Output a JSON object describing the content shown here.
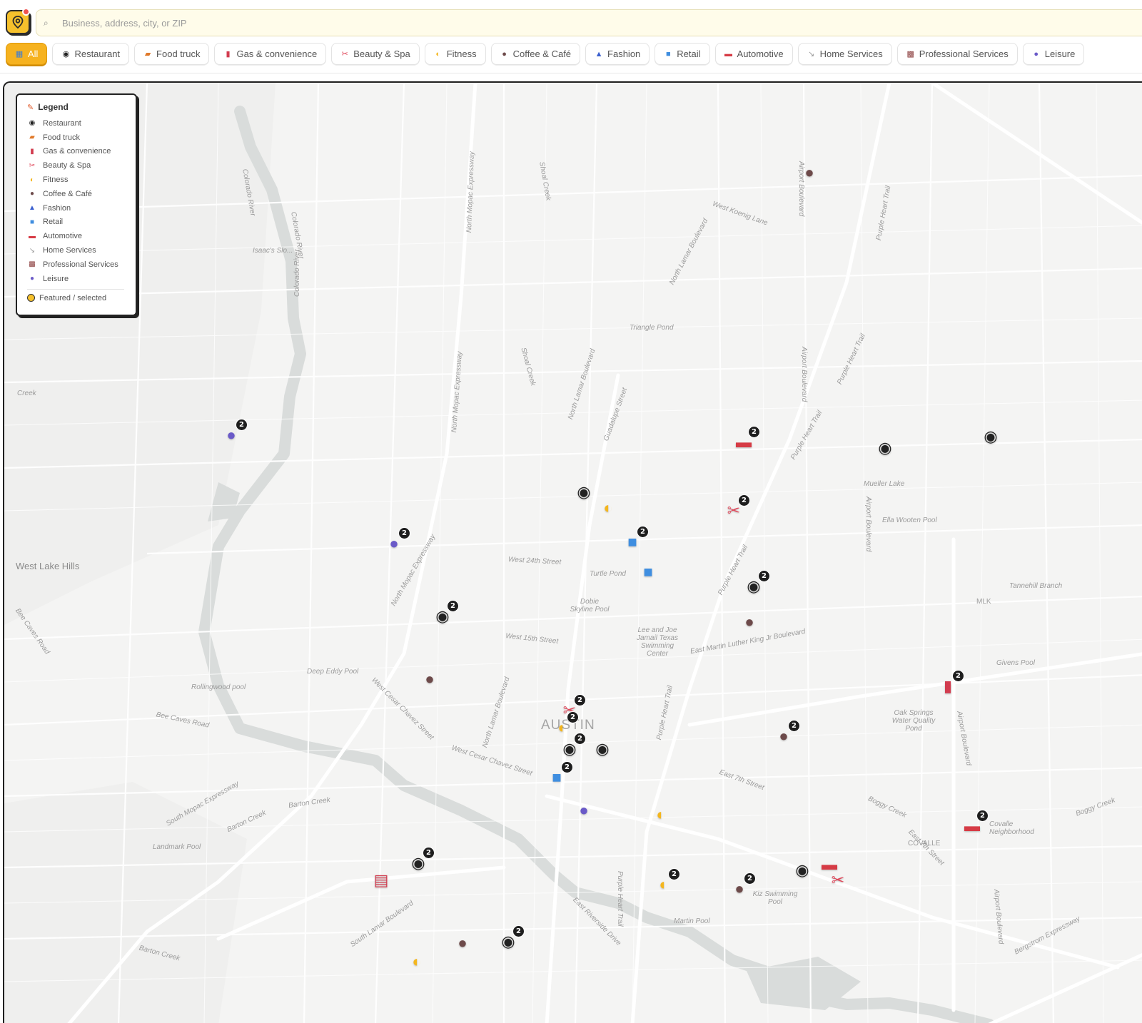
{
  "search": {
    "placeholder": "Business, address, city, or ZIP"
  },
  "chips": [
    {
      "label": "All",
      "icon": "grid-icon",
      "active": true
    },
    {
      "label": "Restaurant",
      "icon": "restaurant-icon"
    },
    {
      "label": "Food truck",
      "icon": "food-truck-icon"
    },
    {
      "label": "Gas & convenience",
      "icon": "gas-pump-icon"
    },
    {
      "label": "Beauty & Spa",
      "icon": "scissors-icon"
    },
    {
      "label": "Fitness",
      "icon": "flexed-arm-icon"
    },
    {
      "label": "Coffee & Café",
      "icon": "coffee-icon"
    },
    {
      "label": "Fashion",
      "icon": "dress-icon"
    },
    {
      "label": "Retail",
      "icon": "shopping-bag-icon"
    },
    {
      "label": "Automotive",
      "icon": "car-icon"
    },
    {
      "label": "Home Services",
      "icon": "wrench-icon"
    },
    {
      "label": "Professional Services",
      "icon": "briefcase-icon"
    },
    {
      "label": "Leisure",
      "icon": "bowling-icon"
    }
  ],
  "legend": {
    "title": "Legend",
    "items": [
      {
        "label": "Restaurant",
        "icon": "restaurant-icon"
      },
      {
        "label": "Food truck",
        "icon": "food-truck-icon"
      },
      {
        "label": "Gas & convenience",
        "icon": "gas-pump-icon"
      },
      {
        "label": "Beauty & Spa",
        "icon": "scissors-icon"
      },
      {
        "label": "Fitness",
        "icon": "flexed-arm-icon"
      },
      {
        "label": "Coffee & Café",
        "icon": "coffee-icon"
      },
      {
        "label": "Fashion",
        "icon": "dress-icon"
      },
      {
        "label": "Retail",
        "icon": "shopping-bag-icon"
      },
      {
        "label": "Automotive",
        "icon": "car-icon"
      },
      {
        "label": "Home Services",
        "icon": "wrench-icon"
      },
      {
        "label": "Professional Services",
        "icon": "briefcase-icon"
      },
      {
        "label": "Leisure",
        "icon": "bowling-icon"
      }
    ],
    "featured_label": "Featured / selected"
  },
  "map_labels": {
    "west_lake_hills": "West Lake Hills",
    "austin": "AUSTIN",
    "covalle": "COVALLE",
    "colorado_river": "Colorado River",
    "north_mopac": "North Mopac Expressway",
    "south_mopac": "South Mopac Expressway",
    "north_lamar": "North Lamar Boulevard",
    "south_lamar": "South Lamar Boulevard",
    "purple_heart": "Purple Heart Trail",
    "airport_blvd": "Airport Boulevard",
    "west_24th": "West 24th Street",
    "west_15th": "West 15th Street",
    "mlk": "East Martin Luther King Jr Boulevard",
    "east_7th": "East 7th Street",
    "cesar_chavez": "West Cesar Chavez Street",
    "barton_creek": "Barton Creek",
    "bee_caves": "Bee Caves Road",
    "boggy_creek": "Boggy Creek",
    "triangle_pond": "Triangle Pond",
    "turtle_pond": "Turtle Pond",
    "dobie": "Dobie Skyline Pool",
    "lee_joe": "Lee and Joe Jamail Texas Swimming Center",
    "deep_eddy": "Deep Eddy Pool",
    "rollingwood": "Rollingwood pool",
    "landmark": "Landmark Pool",
    "martin_pool": "Martin Pool",
    "mueller_lake": "Mueller Lake",
    "ella_wooten": "Ella Wooten Pool",
    "givens": "Givens Pool",
    "oak_springs": "Oak Springs Water Quality Pond",
    "tannehill": "Tannehill Branch",
    "covalle_nbhd": "Covalle Neighborhood",
    "bergstrom": "Bergstrom Expressway",
    "east_riverside": "East Riverside Drive",
    "west_koenig": "West Koenig Lane",
    "guadalupe": "Guadalupe Street",
    "isaacs": "Isaac's Slo...",
    "shoal_creek": "Shoal Creek",
    "creek": "Creek",
    "mlk_short": "MLK",
    "kiz_pool": "Kiz Swimming Pool"
  },
  "markers": [
    {
      "category": "coffee",
      "icon": "coffee-icon",
      "count": null
    },
    {
      "category": "leisure",
      "icon": "bowling-icon",
      "count": 2
    },
    {
      "category": "automotive",
      "icon": "car-icon",
      "count": 2
    },
    {
      "category": "restaurant",
      "icon": "restaurant-icon",
      "count": null
    },
    {
      "category": "restaurant",
      "icon": "restaurant-icon",
      "count": null
    },
    {
      "category": "restaurant",
      "icon": "restaurant-icon",
      "count": null
    },
    {
      "category": "fitness",
      "icon": "flexed-arm-icon",
      "count": null
    },
    {
      "category": "beauty",
      "icon": "scissors-icon",
      "count": 2
    },
    {
      "category": "leisure",
      "icon": "bowling-icon",
      "count": 2
    },
    {
      "category": "retail",
      "icon": "shopping-bag-icon",
      "count": 2
    },
    {
      "category": "retail",
      "icon": "shopping-bag-icon",
      "count": null
    },
    {
      "category": "restaurant",
      "icon": "restaurant-icon",
      "count": 2
    },
    {
      "category": "restaurant",
      "icon": "restaurant-icon",
      "count": 2
    },
    {
      "category": "coffee",
      "icon": "coffee-icon",
      "count": null
    },
    {
      "category": "coffee",
      "icon": "coffee-icon",
      "count": null
    },
    {
      "category": "gas",
      "icon": "gas-pump-icon",
      "count": 2
    },
    {
      "category": "coffee",
      "icon": "coffee-icon",
      "count": 2
    },
    {
      "category": "beauty",
      "icon": "scissors-icon",
      "count": 2
    },
    {
      "category": "fitness",
      "icon": "flexed-arm-icon",
      "count": 2
    },
    {
      "category": "restaurant",
      "icon": "restaurant-icon",
      "count": 2
    },
    {
      "category": "restaurant",
      "icon": "restaurant-icon",
      "count": null
    },
    {
      "category": "retail",
      "icon": "shopping-bag-icon",
      "count": 2
    },
    {
      "category": "leisure",
      "icon": "bowling-icon",
      "count": null
    },
    {
      "category": "fitness",
      "icon": "flexed-arm-icon",
      "count": null
    },
    {
      "category": "automotive",
      "icon": "car-icon",
      "count": 2
    },
    {
      "category": "restaurant",
      "icon": "restaurant-icon",
      "count": 2
    },
    {
      "category": "gas",
      "icon": "convenience-store-icon",
      "count": null
    },
    {
      "category": "fitness",
      "icon": "flexed-arm-icon",
      "count": 2
    },
    {
      "category": "coffee",
      "icon": "coffee-icon",
      "count": 2
    },
    {
      "category": "restaurant",
      "icon": "restaurant-icon",
      "count": null
    },
    {
      "category": "automotive",
      "icon": "car-icon",
      "count": null
    },
    {
      "category": "beauty",
      "icon": "scissors-icon",
      "count": null
    },
    {
      "category": "coffee",
      "icon": "coffee-icon",
      "count": null
    },
    {
      "category": "restaurant",
      "icon": "restaurant-icon",
      "count": 2
    },
    {
      "category": "fitness",
      "icon": "flexed-arm-icon",
      "count": null
    }
  ],
  "colors": {
    "accent": "#f6b21f",
    "badge": "#1e1e1e",
    "map_bg": "#f4f4f3",
    "water": "#d6d9d8",
    "road": "#ffffff"
  }
}
